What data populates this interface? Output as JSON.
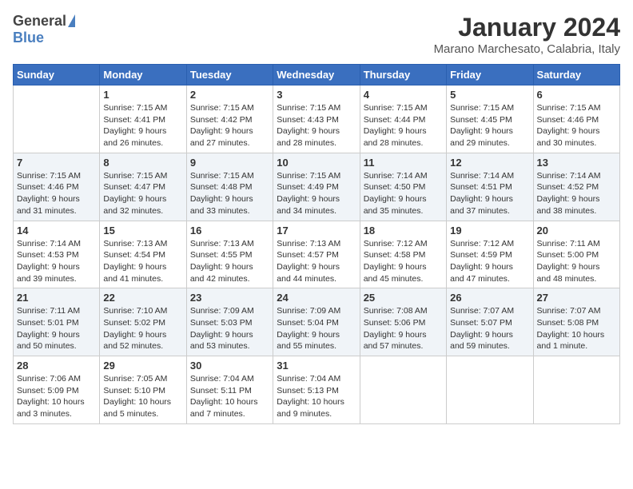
{
  "header": {
    "logo_general": "General",
    "logo_blue": "Blue",
    "title": "January 2024",
    "subtitle": "Marano Marchesato, Calabria, Italy"
  },
  "columns": [
    "Sunday",
    "Monday",
    "Tuesday",
    "Wednesday",
    "Thursday",
    "Friday",
    "Saturday"
  ],
  "weeks": [
    [
      {
        "day": "",
        "info": ""
      },
      {
        "day": "1",
        "info": "Sunrise: 7:15 AM\nSunset: 4:41 PM\nDaylight: 9 hours\nand 26 minutes."
      },
      {
        "day": "2",
        "info": "Sunrise: 7:15 AM\nSunset: 4:42 PM\nDaylight: 9 hours\nand 27 minutes."
      },
      {
        "day": "3",
        "info": "Sunrise: 7:15 AM\nSunset: 4:43 PM\nDaylight: 9 hours\nand 28 minutes."
      },
      {
        "day": "4",
        "info": "Sunrise: 7:15 AM\nSunset: 4:44 PM\nDaylight: 9 hours\nand 28 minutes."
      },
      {
        "day": "5",
        "info": "Sunrise: 7:15 AM\nSunset: 4:45 PM\nDaylight: 9 hours\nand 29 minutes."
      },
      {
        "day": "6",
        "info": "Sunrise: 7:15 AM\nSunset: 4:46 PM\nDaylight: 9 hours\nand 30 minutes."
      }
    ],
    [
      {
        "day": "7",
        "info": "Sunrise: 7:15 AM\nSunset: 4:46 PM\nDaylight: 9 hours\nand 31 minutes."
      },
      {
        "day": "8",
        "info": "Sunrise: 7:15 AM\nSunset: 4:47 PM\nDaylight: 9 hours\nand 32 minutes."
      },
      {
        "day": "9",
        "info": "Sunrise: 7:15 AM\nSunset: 4:48 PM\nDaylight: 9 hours\nand 33 minutes."
      },
      {
        "day": "10",
        "info": "Sunrise: 7:15 AM\nSunset: 4:49 PM\nDaylight: 9 hours\nand 34 minutes."
      },
      {
        "day": "11",
        "info": "Sunrise: 7:14 AM\nSunset: 4:50 PM\nDaylight: 9 hours\nand 35 minutes."
      },
      {
        "day": "12",
        "info": "Sunrise: 7:14 AM\nSunset: 4:51 PM\nDaylight: 9 hours\nand 37 minutes."
      },
      {
        "day": "13",
        "info": "Sunrise: 7:14 AM\nSunset: 4:52 PM\nDaylight: 9 hours\nand 38 minutes."
      }
    ],
    [
      {
        "day": "14",
        "info": "Sunrise: 7:14 AM\nSunset: 4:53 PM\nDaylight: 9 hours\nand 39 minutes."
      },
      {
        "day": "15",
        "info": "Sunrise: 7:13 AM\nSunset: 4:54 PM\nDaylight: 9 hours\nand 41 minutes."
      },
      {
        "day": "16",
        "info": "Sunrise: 7:13 AM\nSunset: 4:55 PM\nDaylight: 9 hours\nand 42 minutes."
      },
      {
        "day": "17",
        "info": "Sunrise: 7:13 AM\nSunset: 4:57 PM\nDaylight: 9 hours\nand 44 minutes."
      },
      {
        "day": "18",
        "info": "Sunrise: 7:12 AM\nSunset: 4:58 PM\nDaylight: 9 hours\nand 45 minutes."
      },
      {
        "day": "19",
        "info": "Sunrise: 7:12 AM\nSunset: 4:59 PM\nDaylight: 9 hours\nand 47 minutes."
      },
      {
        "day": "20",
        "info": "Sunrise: 7:11 AM\nSunset: 5:00 PM\nDaylight: 9 hours\nand 48 minutes."
      }
    ],
    [
      {
        "day": "21",
        "info": "Sunrise: 7:11 AM\nSunset: 5:01 PM\nDaylight: 9 hours\nand 50 minutes."
      },
      {
        "day": "22",
        "info": "Sunrise: 7:10 AM\nSunset: 5:02 PM\nDaylight: 9 hours\nand 52 minutes."
      },
      {
        "day": "23",
        "info": "Sunrise: 7:09 AM\nSunset: 5:03 PM\nDaylight: 9 hours\nand 53 minutes."
      },
      {
        "day": "24",
        "info": "Sunrise: 7:09 AM\nSunset: 5:04 PM\nDaylight: 9 hours\nand 55 minutes."
      },
      {
        "day": "25",
        "info": "Sunrise: 7:08 AM\nSunset: 5:06 PM\nDaylight: 9 hours\nand 57 minutes."
      },
      {
        "day": "26",
        "info": "Sunrise: 7:07 AM\nSunset: 5:07 PM\nDaylight: 9 hours\nand 59 minutes."
      },
      {
        "day": "27",
        "info": "Sunrise: 7:07 AM\nSunset: 5:08 PM\nDaylight: 10 hours\nand 1 minute."
      }
    ],
    [
      {
        "day": "28",
        "info": "Sunrise: 7:06 AM\nSunset: 5:09 PM\nDaylight: 10 hours\nand 3 minutes."
      },
      {
        "day": "29",
        "info": "Sunrise: 7:05 AM\nSunset: 5:10 PM\nDaylight: 10 hours\nand 5 minutes."
      },
      {
        "day": "30",
        "info": "Sunrise: 7:04 AM\nSunset: 5:11 PM\nDaylight: 10 hours\nand 7 minutes."
      },
      {
        "day": "31",
        "info": "Sunrise: 7:04 AM\nSunset: 5:13 PM\nDaylight: 10 hours\nand 9 minutes."
      },
      {
        "day": "",
        "info": ""
      },
      {
        "day": "",
        "info": ""
      },
      {
        "day": "",
        "info": ""
      }
    ]
  ]
}
